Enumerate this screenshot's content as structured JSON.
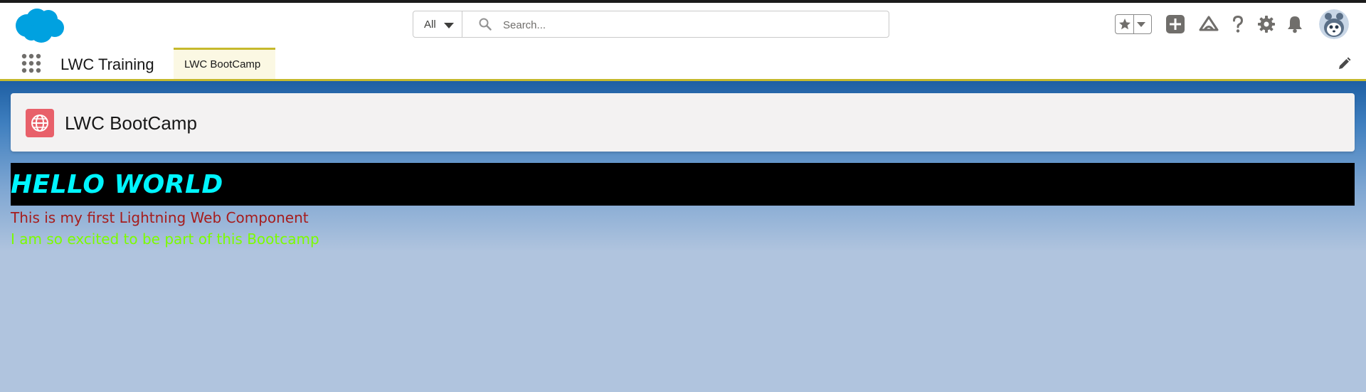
{
  "header": {
    "logo": "salesforce-cloud-icon",
    "search_scope": "All",
    "search_placeholder": "Search...",
    "icons": [
      "favorites-star-icon",
      "favorites-dropdown-icon",
      "add-icon",
      "trailhead-icon",
      "help-icon",
      "gear-icon",
      "bell-icon",
      "avatar"
    ]
  },
  "nav": {
    "app_launcher_icon": "app-launcher-icon",
    "app_name": "LWC Training",
    "tabs": [
      {
        "label": "LWC BootCamp",
        "active": true
      }
    ],
    "edit_icon": "pencil-icon"
  },
  "page_header": {
    "icon": "globe-icon",
    "title": "LWC BootCamp"
  },
  "component": {
    "heading": "HELLO WORLD",
    "line1": "This is my first Lightning Web Component",
    "line2": "I am so excited to be part of this Bootcamp"
  },
  "colors": {
    "brand_blue": "#00a1e0",
    "accent_yellow": "#c6b92c",
    "heading_color": "#00f5ff",
    "line1_color": "#a61c1c",
    "line2_color": "#7cfc00",
    "page_icon_bg": "#e8606a"
  }
}
